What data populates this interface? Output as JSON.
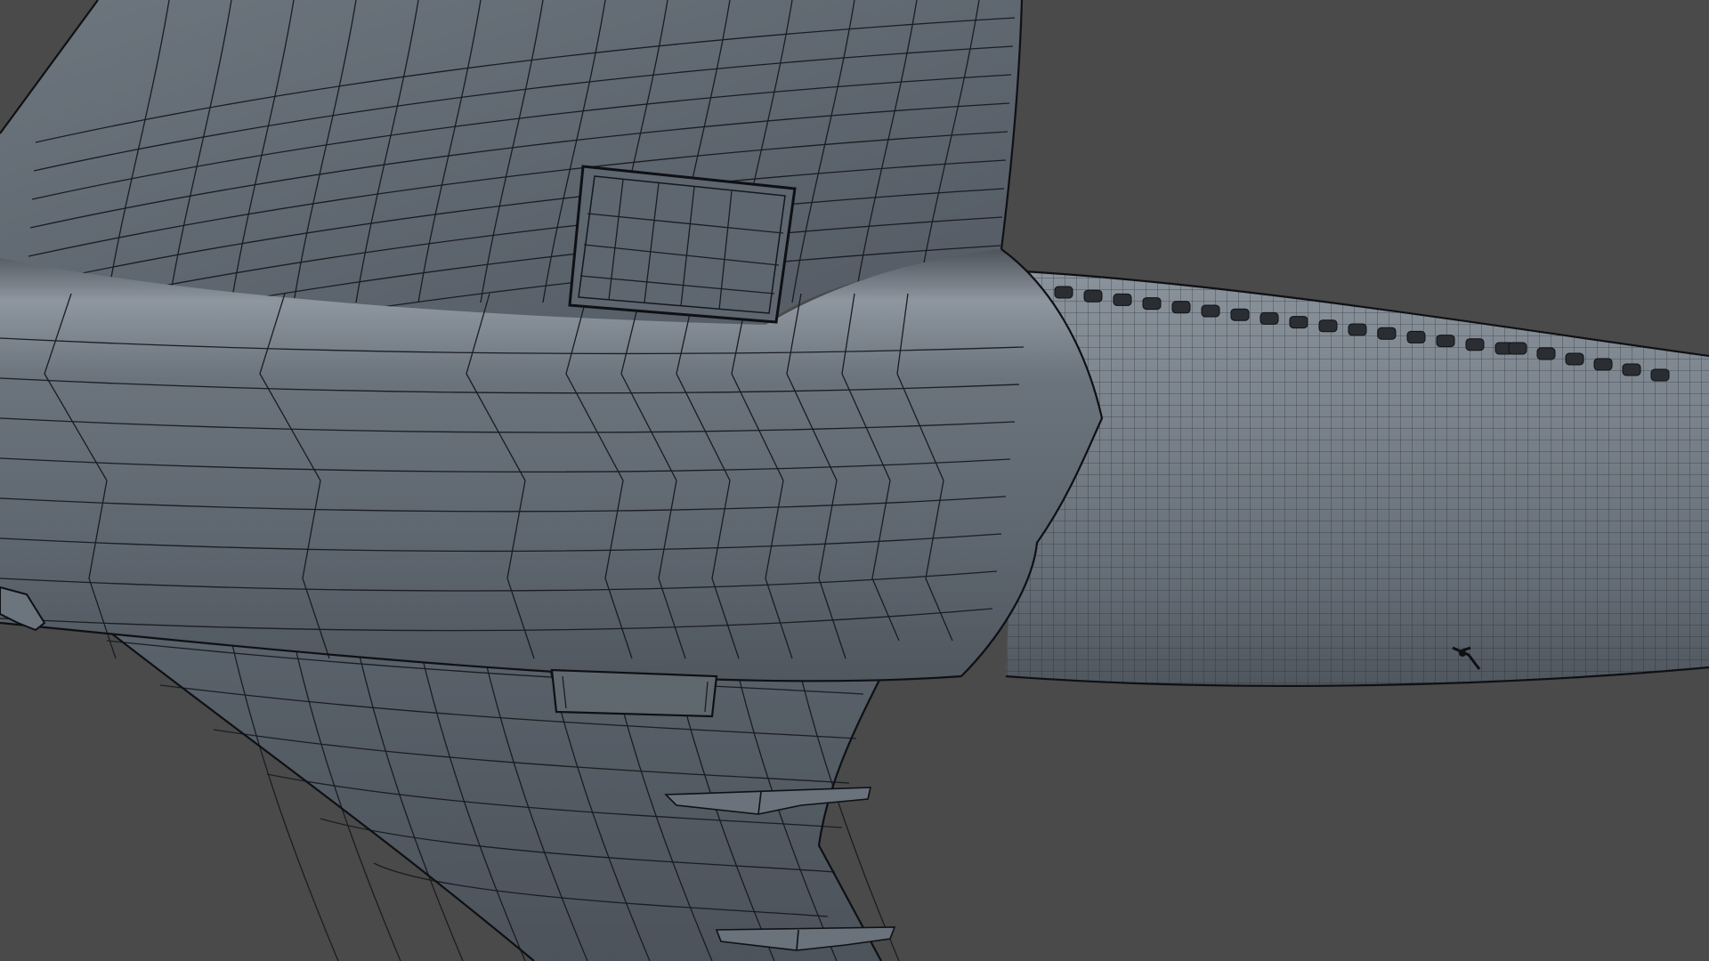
{
  "viewport": {
    "background_color": "#4a4a4a",
    "mesh_face_color": "#5e6670",
    "mesh_highlight_color": "#9aa3ac",
    "wire_color": "#1a1d22",
    "display_mode": "wireframe-on-shaded"
  },
  "scene": {
    "subject": "aircraft-wing-root-and-fuselage",
    "parts": [
      {
        "name": "upper-wing",
        "type": "mesh"
      },
      {
        "name": "wing-root-fairing",
        "type": "mesh"
      },
      {
        "name": "fuselage",
        "type": "mesh"
      },
      {
        "name": "fuselage-windows",
        "type": "mesh"
      },
      {
        "name": "lower-wing",
        "type": "mesh"
      },
      {
        "name": "upper-wing-panel",
        "type": "mesh"
      },
      {
        "name": "lower-fairing-panel",
        "type": "mesh"
      },
      {
        "name": "flap-track-fairing-1",
        "type": "mesh"
      },
      {
        "name": "flap-track-fairing-2",
        "type": "mesh"
      },
      {
        "name": "fuselage-antenna",
        "type": "mesh"
      },
      {
        "name": "wing-fence",
        "type": "mesh"
      }
    ]
  }
}
